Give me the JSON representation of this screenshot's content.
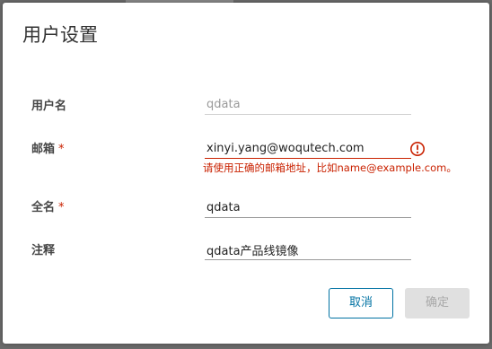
{
  "dialog": {
    "title": "用户设置"
  },
  "fields": {
    "username": {
      "label": "用户名",
      "value": "qdata",
      "required": false,
      "readonly": true
    },
    "email": {
      "label": "邮箱",
      "required_mark": "*",
      "value": "xinyi.yang@woqutech.com",
      "error_message": "请使用正确的邮箱地址，比如name@example.com。",
      "error_icon": "exclamation-circle-icon",
      "status": "invalid"
    },
    "fullname": {
      "label": "全名",
      "required_mark": "*",
      "value": "qdata"
    },
    "comment": {
      "label": "注释",
      "value": "qdata产品线镜像"
    }
  },
  "buttons": {
    "cancel_label": "取消",
    "ok_label": "确定",
    "ok_disabled": true
  },
  "colors": {
    "primary": "#0072a3",
    "error": "#c92100",
    "disabled_bg": "#e0e0e0"
  }
}
